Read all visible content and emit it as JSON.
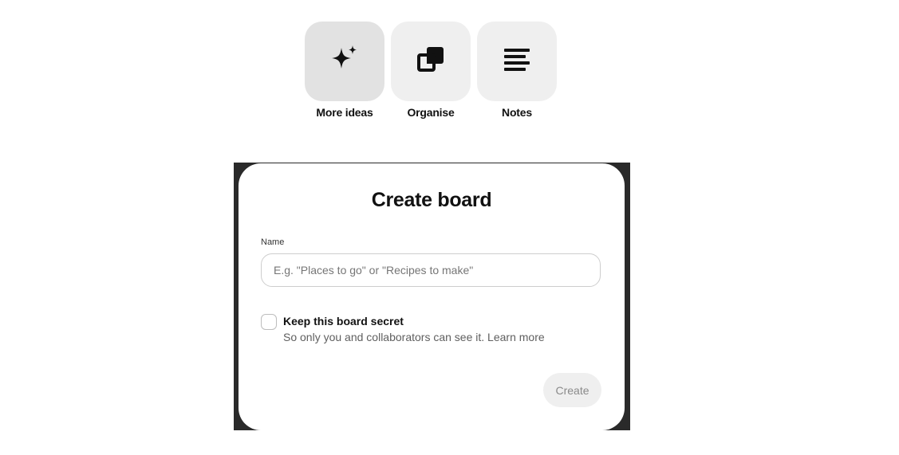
{
  "quick_actions": [
    {
      "label": "More ideas",
      "icon": "sparkle-icon",
      "active": true
    },
    {
      "label": "Organise",
      "icon": "organise-icon",
      "active": false
    },
    {
      "label": "Notes",
      "icon": "notes-icon",
      "active": false
    }
  ],
  "modal": {
    "title": "Create board",
    "name_label": "Name",
    "name_value": "",
    "name_placeholder": "E.g. \"Places to go\" or \"Recipes to make\"",
    "secret_checked": false,
    "secret_title": "Keep this board secret",
    "secret_description": "So only you and collaborators can see it.",
    "learn_more": "Learn more",
    "create_label": "Create"
  },
  "colors": {
    "tile_background": "#efefef",
    "tile_active_background": "#e2e2e2",
    "backdrop": "#2a2a2a",
    "disabled_button_text": "#8a8a8a"
  }
}
